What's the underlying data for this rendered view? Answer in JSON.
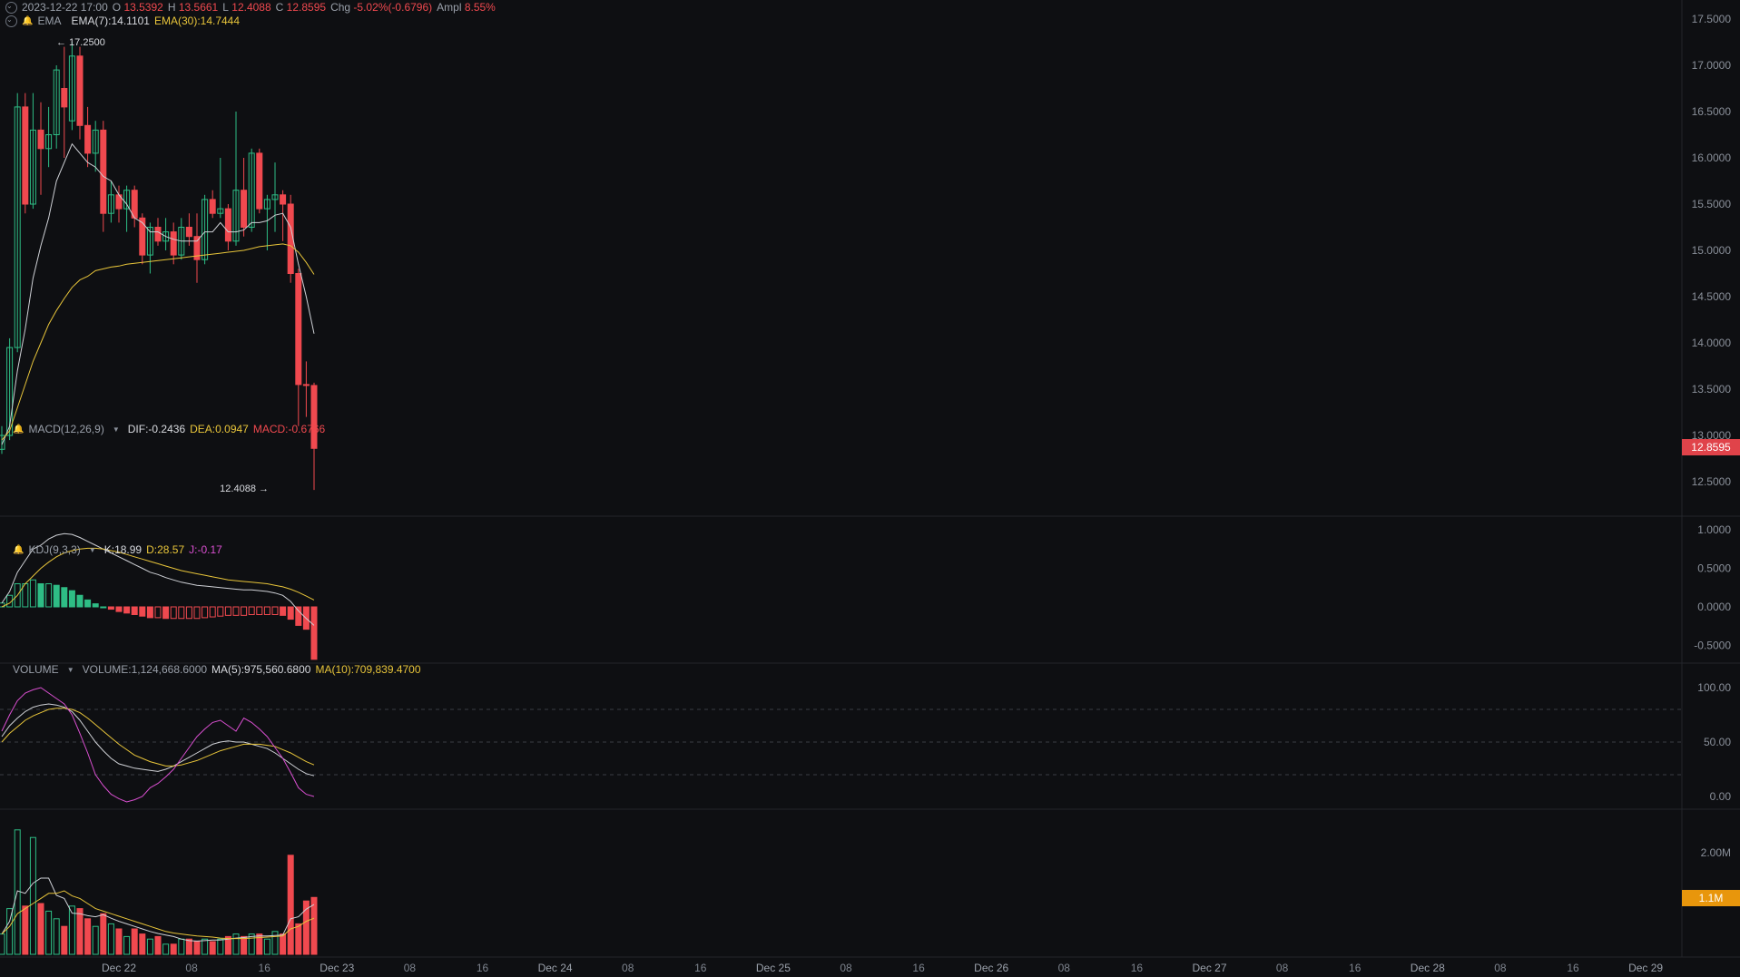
{
  "header": {
    "datetime": "2023-12-22 17:00",
    "o_label": "O",
    "o_value": "13.5392",
    "h_label": "H",
    "h_value": "13.5661",
    "l_label": "L",
    "l_value": "12.4088",
    "c_label": "C",
    "c_value": "12.8595",
    "chg_label": "Chg",
    "chg_value": "-5.02%(-0.6796)",
    "ampl_label": "Ampl",
    "ampl_value": "8.55%"
  },
  "ema_legend": {
    "name": "EMA",
    "ema7": "EMA(7):14.1101",
    "ema30": "EMA(30):14.7444"
  },
  "macd_legend": {
    "name": "MACD(12,26,9)",
    "dif": "DIF:-0.2436",
    "dea": "DEA:0.0947",
    "macd": "MACD:-0.6766"
  },
  "kdj_legend": {
    "name": "KDJ(9,3,3)",
    "k": "K:18.99",
    "d": "D:28.57",
    "j": "J:-0.17"
  },
  "volume_legend": {
    "name": "VOLUME",
    "volume": "VOLUME:1,124,668.6000",
    "ma5": "MA(5):975,560.6800",
    "ma10": "MA(10):709,839.4700"
  },
  "annotations": {
    "high": "17.2500",
    "low": "12.4088"
  },
  "price_axis": [
    "17.5000",
    "17.0000",
    "16.5000",
    "16.0000",
    "15.5000",
    "15.0000",
    "14.5000",
    "14.0000",
    "13.5000",
    "13.0000",
    "12.5000"
  ],
  "current_price_tag": "12.8595",
  "macd_axis": [
    "1.0000",
    "0.5000",
    "0.0000",
    "-0.5000"
  ],
  "kdj_axis": [
    "100.00",
    "50.00",
    "0.00"
  ],
  "volume_axis": [
    "2.00M"
  ],
  "current_volume_tag": "1.1M",
  "time_axis": [
    "Dec 22",
    "08",
    "16",
    "Dec 23",
    "08",
    "16",
    "Dec 24",
    "08",
    "16",
    "Dec 25",
    "08",
    "16",
    "Dec 26",
    "08",
    "16",
    "Dec 27",
    "08",
    "16",
    "Dec 28",
    "08",
    "16",
    "Dec 29"
  ],
  "colors": {
    "background": "#0e0f12",
    "up": "#2ebd85",
    "down": "#f0494f",
    "ema7": "#cfd1d6",
    "ema30": "#e8c53a",
    "j_line": "#d94fd0",
    "volume_tag": "#e8960c"
  },
  "chart_data": {
    "type": "candlestick",
    "interval": "1h",
    "candles": [
      {
        "o": 12.85,
        "h": 13.1,
        "l": 12.8,
        "c": 13.0
      },
      {
        "o": 13.0,
        "h": 14.05,
        "l": 12.95,
        "c": 13.95
      },
      {
        "o": 13.95,
        "h": 16.7,
        "l": 13.9,
        "c": 16.55
      },
      {
        "o": 16.55,
        "h": 16.7,
        "l": 15.4,
        "c": 15.5
      },
      {
        "o": 15.5,
        "h": 16.7,
        "l": 15.45,
        "c": 16.3
      },
      {
        "o": 16.3,
        "h": 16.6,
        "l": 15.6,
        "c": 16.1
      },
      {
        "o": 16.1,
        "h": 16.55,
        "l": 15.9,
        "c": 16.25
      },
      {
        "o": 16.25,
        "h": 17.0,
        "l": 16.1,
        "c": 16.95
      },
      {
        "o": 16.75,
        "h": 17.2,
        "l": 16.0,
        "c": 16.55
      },
      {
        "o": 16.4,
        "h": 17.25,
        "l": 16.3,
        "c": 17.1
      },
      {
        "o": 17.1,
        "h": 17.2,
        "l": 16.2,
        "c": 16.35
      },
      {
        "o": 16.35,
        "h": 16.55,
        "l": 15.9,
        "c": 16.05
      },
      {
        "o": 16.05,
        "h": 16.4,
        "l": 15.85,
        "c": 16.3
      },
      {
        "o": 16.3,
        "h": 16.4,
        "l": 15.2,
        "c": 15.4
      },
      {
        "o": 15.4,
        "h": 15.75,
        "l": 15.3,
        "c": 15.6
      },
      {
        "o": 15.6,
        "h": 15.7,
        "l": 15.3,
        "c": 15.45
      },
      {
        "o": 15.45,
        "h": 15.7,
        "l": 15.2,
        "c": 15.65
      },
      {
        "o": 15.65,
        "h": 15.7,
        "l": 15.25,
        "c": 15.35
      },
      {
        "o": 15.35,
        "h": 15.4,
        "l": 14.85,
        "c": 14.95
      },
      {
        "o": 14.95,
        "h": 15.3,
        "l": 14.75,
        "c": 15.25
      },
      {
        "o": 15.25,
        "h": 15.35,
        "l": 15.05,
        "c": 15.1
      },
      {
        "o": 15.1,
        "h": 15.35,
        "l": 15.0,
        "c": 15.2
      },
      {
        "o": 15.2,
        "h": 15.3,
        "l": 14.85,
        "c": 14.95
      },
      {
        "o": 14.95,
        "h": 15.35,
        "l": 14.9,
        "c": 15.25
      },
      {
        "o": 15.25,
        "h": 15.4,
        "l": 15.05,
        "c": 15.15
      },
      {
        "o": 15.15,
        "h": 15.4,
        "l": 14.65,
        "c": 14.9
      },
      {
        "o": 14.9,
        "h": 15.6,
        "l": 14.85,
        "c": 15.55
      },
      {
        "o": 15.55,
        "h": 15.65,
        "l": 15.35,
        "c": 15.4
      },
      {
        "o": 15.4,
        "h": 16.0,
        "l": 15.35,
        "c": 15.45
      },
      {
        "o": 15.45,
        "h": 15.5,
        "l": 15.0,
        "c": 15.1
      },
      {
        "o": 15.1,
        "h": 16.5,
        "l": 15.05,
        "c": 15.65
      },
      {
        "o": 15.65,
        "h": 16.0,
        "l": 15.15,
        "c": 15.25
      },
      {
        "o": 15.25,
        "h": 16.1,
        "l": 15.2,
        "c": 16.05
      },
      {
        "o": 16.05,
        "h": 16.1,
        "l": 15.4,
        "c": 15.45
      },
      {
        "o": 15.45,
        "h": 15.6,
        "l": 15.0,
        "c": 15.55
      },
      {
        "o": 15.55,
        "h": 15.95,
        "l": 15.2,
        "c": 15.6
      },
      {
        "o": 15.6,
        "h": 15.65,
        "l": 15.1,
        "c": 15.5
      },
      {
        "o": 15.5,
        "h": 15.6,
        "l": 14.65,
        "c": 14.75
      },
      {
        "o": 14.75,
        "h": 14.8,
        "l": 13.1,
        "c": 13.55
      },
      {
        "o": 13.55,
        "h": 13.8,
        "l": 13.2,
        "c": 13.54
      },
      {
        "o": 13.54,
        "h": 13.57,
        "l": 12.41,
        "c": 12.86
      }
    ],
    "ema7": [
      12.9,
      13.1,
      13.7,
      14.15,
      14.7,
      15.05,
      15.35,
      15.75,
      15.95,
      16.15,
      16.05,
      15.95,
      15.9,
      15.8,
      15.75,
      15.6,
      15.5,
      15.35,
      15.3,
      15.2,
      15.2,
      15.15,
      15.12,
      15.1,
      15.1,
      15.1,
      15.2,
      15.2,
      15.3,
      15.2,
      15.2,
      15.22,
      15.3,
      15.3,
      15.32,
      15.38,
      15.4,
      15.25,
      14.85,
      14.5,
      14.1
    ],
    "ema30": [
      12.95,
      13.05,
      13.3,
      13.55,
      13.8,
      14.0,
      14.2,
      14.35,
      14.48,
      14.6,
      14.68,
      14.72,
      14.78,
      14.8,
      14.82,
      14.83,
      14.85,
      14.86,
      14.87,
      14.88,
      14.89,
      14.9,
      14.91,
      14.92,
      14.93,
      14.94,
      14.95,
      14.96,
      14.97,
      14.98,
      14.99,
      15.0,
      15.02,
      15.04,
      15.05,
      15.06,
      15.07,
      15.05,
      14.98,
      14.87,
      14.74
    ],
    "macd": {
      "dif": [
        0.05,
        0.2,
        0.45,
        0.6,
        0.75,
        0.8,
        0.88,
        0.93,
        0.95,
        0.94,
        0.9,
        0.85,
        0.8,
        0.75,
        0.7,
        0.65,
        0.6,
        0.55,
        0.5,
        0.45,
        0.42,
        0.38,
        0.35,
        0.32,
        0.3,
        0.28,
        0.27,
        0.26,
        0.25,
        0.24,
        0.23,
        0.22,
        0.22,
        0.21,
        0.2,
        0.18,
        0.15,
        0.07,
        -0.05,
        -0.15,
        -0.24
      ],
      "dea": [
        0.0,
        0.05,
        0.15,
        0.3,
        0.4,
        0.5,
        0.58,
        0.65,
        0.7,
        0.73,
        0.75,
        0.76,
        0.76,
        0.75,
        0.73,
        0.71,
        0.68,
        0.65,
        0.62,
        0.59,
        0.56,
        0.53,
        0.5,
        0.47,
        0.45,
        0.43,
        0.41,
        0.39,
        0.37,
        0.35,
        0.34,
        0.33,
        0.32,
        0.31,
        0.3,
        0.28,
        0.26,
        0.23,
        0.19,
        0.14,
        0.09
      ],
      "hist": [
        0.05,
        0.15,
        0.3,
        0.3,
        0.35,
        0.3,
        0.3,
        0.28,
        0.25,
        0.21,
        0.15,
        0.09,
        0.04,
        0.0,
        -0.03,
        -0.06,
        -0.08,
        -0.1,
        -0.12,
        -0.14,
        -0.14,
        -0.15,
        -0.15,
        -0.15,
        -0.15,
        -0.15,
        -0.14,
        -0.13,
        -0.12,
        -0.11,
        -0.11,
        -0.11,
        -0.1,
        -0.1,
        -0.1,
        -0.1,
        -0.11,
        -0.16,
        -0.24,
        -0.29,
        -0.68
      ]
    },
    "kdj": {
      "k": [
        55,
        65,
        72,
        78,
        82,
        84,
        85,
        84,
        82,
        78,
        70,
        60,
        50,
        42,
        35,
        30,
        28,
        26,
        25,
        24,
        23,
        25,
        28,
        32,
        36,
        40,
        44,
        48,
        50,
        51,
        50,
        50,
        48,
        46,
        44,
        40,
        35,
        30,
        25,
        21,
        19
      ],
      "d": [
        50,
        58,
        64,
        70,
        74,
        77,
        80,
        81,
        81,
        80,
        77,
        72,
        66,
        60,
        54,
        48,
        43,
        38,
        35,
        32,
        30,
        28,
        28,
        29,
        31,
        33,
        36,
        39,
        42,
        44,
        46,
        48,
        48,
        48,
        47,
        46,
        43,
        40,
        36,
        32,
        29
      ],
      "j": [
        60,
        75,
        88,
        95,
        98,
        100,
        95,
        90,
        85,
        75,
        58,
        40,
        20,
        10,
        2,
        -2,
        -5,
        -3,
        0,
        8,
        12,
        18,
        25,
        35,
        45,
        55,
        62,
        68,
        70,
        65,
        60,
        72,
        68,
        62,
        55,
        45,
        35,
        22,
        8,
        2,
        0
      ]
    },
    "volume": {
      "values": [
        0.4,
        0.9,
        2.45,
        0.95,
        2.3,
        1.0,
        0.85,
        0.7,
        0.55,
        0.95,
        0.9,
        0.7,
        0.55,
        0.8,
        0.6,
        0.5,
        0.35,
        0.5,
        0.4,
        0.3,
        0.35,
        0.2,
        0.2,
        0.3,
        0.3,
        0.25,
        0.3,
        0.25,
        0.3,
        0.35,
        0.4,
        0.35,
        0.4,
        0.4,
        0.3,
        0.45,
        0.4,
        1.95,
        0.6,
        1.05,
        1.12
      ],
      "ma5": [
        0.4,
        0.65,
        1.25,
        1.2,
        1.4,
        1.5,
        1.5,
        1.16,
        1.1,
        0.81,
        0.8,
        0.76,
        0.74,
        0.78,
        0.71,
        0.65,
        0.6,
        0.55,
        0.5,
        0.45,
        0.41,
        0.38,
        0.35,
        0.3,
        0.27,
        0.26,
        0.27,
        0.28,
        0.28,
        0.3,
        0.32,
        0.33,
        0.35,
        0.36,
        0.36,
        0.37,
        0.38,
        0.7,
        0.74,
        0.89,
        0.98
      ],
      "ma10": [
        0.4,
        0.55,
        0.8,
        0.9,
        1.0,
        1.1,
        1.2,
        1.2,
        1.25,
        1.15,
        1.1,
        1.0,
        0.9,
        0.85,
        0.8,
        0.75,
        0.7,
        0.65,
        0.6,
        0.55,
        0.5,
        0.45,
        0.42,
        0.4,
        0.38,
        0.36,
        0.35,
        0.34,
        0.32,
        0.31,
        0.31,
        0.31,
        0.32,
        0.33,
        0.34,
        0.35,
        0.36,
        0.5,
        0.55,
        0.65,
        0.71
      ]
    }
  }
}
